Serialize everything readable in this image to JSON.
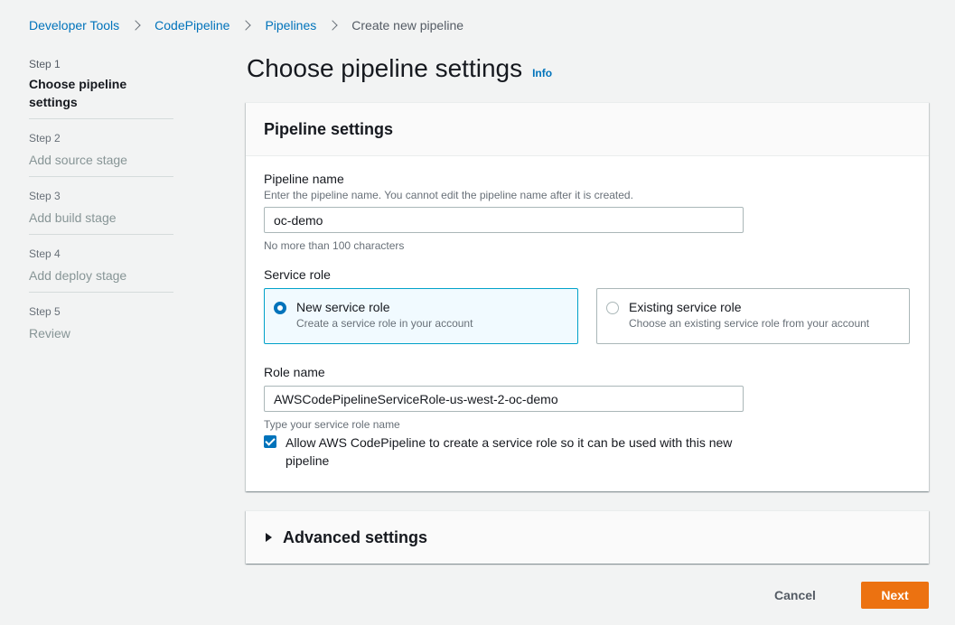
{
  "breadcrumb": {
    "items": [
      "Developer Tools",
      "CodePipeline",
      "Pipelines"
    ],
    "current": "Create new pipeline"
  },
  "steps": [
    {
      "num": "Step 1",
      "label": "Choose pipeline settings",
      "active": true
    },
    {
      "num": "Step 2",
      "label": "Add source stage",
      "active": false
    },
    {
      "num": "Step 3",
      "label": "Add build stage",
      "active": false
    },
    {
      "num": "Step 4",
      "label": "Add deploy stage",
      "active": false
    },
    {
      "num": "Step 5",
      "label": "Review",
      "active": false
    }
  ],
  "page": {
    "title": "Choose pipeline settings",
    "info": "Info"
  },
  "settings": {
    "header": "Pipeline settings",
    "pipeline_name": {
      "label": "Pipeline name",
      "description": "Enter the pipeline name. You cannot edit the pipeline name after it is created.",
      "value": "oc-demo",
      "constraint": "No more than 100 characters"
    },
    "service_role": {
      "label": "Service role",
      "options": [
        {
          "title": "New service role",
          "desc": "Create a service role in your account",
          "selected": true
        },
        {
          "title": "Existing service role",
          "desc": "Choose an existing service role from your account",
          "selected": false
        }
      ]
    },
    "role_name": {
      "label": "Role name",
      "value": "AWSCodePipelineServiceRole-us-west-2-oc-demo",
      "constraint": "Type your service role name"
    },
    "allow_checkbox": {
      "label": "Allow AWS CodePipeline to create a service role so it can be used with this new pipeline",
      "checked": true
    }
  },
  "advanced": {
    "header": "Advanced settings"
  },
  "footer": {
    "cancel": "Cancel",
    "next": "Next"
  },
  "colors": {
    "link": "#0073bb",
    "primary_button": "#ec7211",
    "selected_tile_border": "#00a1c9",
    "selected_tile_bg": "#f1faff"
  }
}
